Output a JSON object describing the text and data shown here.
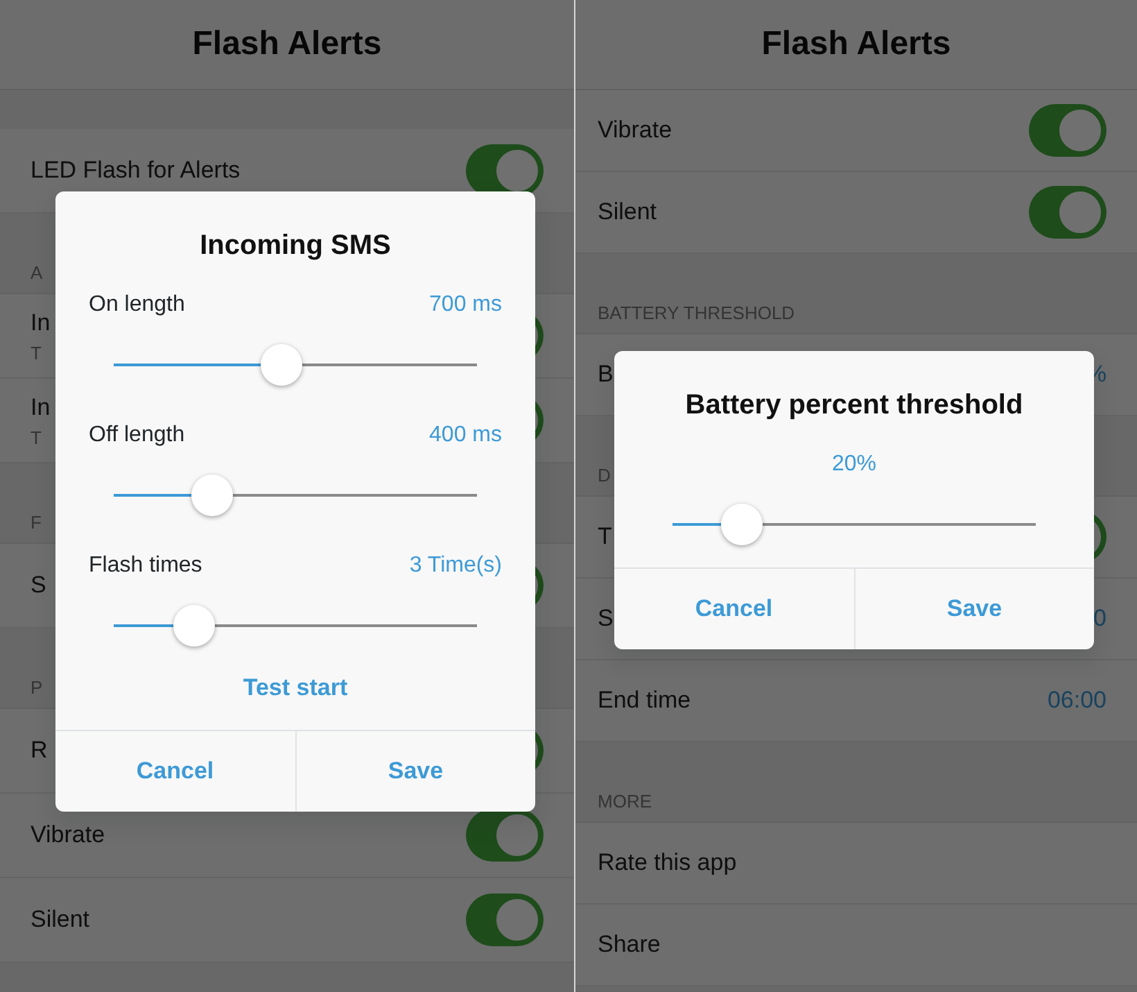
{
  "screens": [
    {
      "title": "Flash Alerts",
      "items": [
        {
          "kind": "spacer"
        },
        {
          "kind": "toggle",
          "label": "LED Flash for Alerts",
          "on": true
        },
        {
          "kind": "spacer"
        },
        {
          "kind": "section",
          "label": "A"
        },
        {
          "kind": "toggle",
          "label": "In",
          "subtitle": "T",
          "on": true
        },
        {
          "kind": "toggle",
          "label": "In",
          "subtitle": "T",
          "on": true
        },
        {
          "kind": "spacer"
        },
        {
          "kind": "section",
          "label": "F"
        },
        {
          "kind": "toggle",
          "label": "S",
          "on": true
        },
        {
          "kind": "spacer"
        },
        {
          "kind": "section",
          "label": "P"
        },
        {
          "kind": "toggle",
          "label": "R",
          "on": true
        },
        {
          "kind": "toggle",
          "label": "Vibrate",
          "on": true
        },
        {
          "kind": "toggle",
          "label": "Silent",
          "on": true
        }
      ],
      "dialog": {
        "title": "Incoming SMS",
        "sliders": [
          {
            "label": "On length",
            "value": "700 ms",
            "level": 0.46
          },
          {
            "label": "Off length",
            "value": "400 ms",
            "level": 0.27
          },
          {
            "label": "Flash times",
            "value": "3 Time(s)",
            "level": 0.22
          }
        ],
        "action": "Test start",
        "buttons": [
          "Cancel",
          "Save"
        ]
      }
    },
    {
      "title": "Flash Alerts",
      "items": [
        {
          "kind": "toggle",
          "label": "Vibrate",
          "on": true
        },
        {
          "kind": "toggle",
          "label": "Silent",
          "on": true
        },
        {
          "kind": "spacer"
        },
        {
          "kind": "section",
          "label": "BATTERY THRESHOLD"
        },
        {
          "kind": "value",
          "label": "B",
          "value": "%"
        },
        {
          "kind": "spacer"
        },
        {
          "kind": "section",
          "label": "D"
        },
        {
          "kind": "toggle",
          "label": "T",
          "on": true
        },
        {
          "kind": "value",
          "label": "S",
          "value": "0"
        },
        {
          "kind": "value",
          "label": "End time",
          "value": "06:00"
        },
        {
          "kind": "spacer"
        },
        {
          "kind": "section",
          "label": "MORE"
        },
        {
          "kind": "link",
          "label": "Rate this app"
        },
        {
          "kind": "link",
          "label": "Share"
        }
      ],
      "dialog": {
        "title": "Battery percent threshold",
        "sliders": [
          {
            "value": "20%",
            "level": 0.19
          }
        ],
        "buttons": [
          "Cancel",
          "Save"
        ]
      }
    }
  ]
}
